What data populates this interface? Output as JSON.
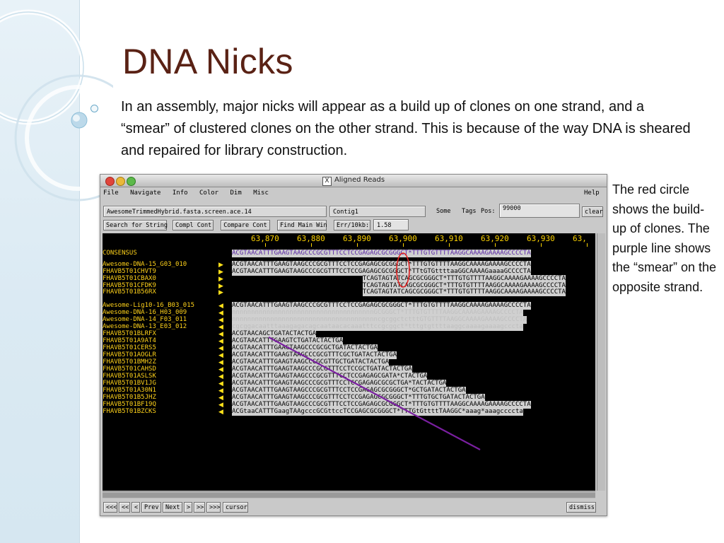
{
  "slide": {
    "title": "DNA Nicks",
    "intro": "In an assembly, major nicks will appear as a build up of clones on one strand, and a “smear” of clustered clones on the other strand. This is because of the way DNA is sheared and repaired for library construction.",
    "side_note": "The red circle shows the build-up of clones. The purple line shows the “smear” on the opposite strand."
  },
  "window": {
    "title": "Aligned Reads",
    "menu": [
      "File",
      "Navigate",
      "Info",
      "Color",
      "Dim",
      "Misc"
    ],
    "help": "Help",
    "file_field": "AwesomeTrimmedHybrid.fasta.screen.ace.14",
    "contig_field": "Contig1",
    "some_button": "Some",
    "tags_button": "Tags",
    "pos_label": "Pos:",
    "pos_value": "99000",
    "clear_button": "clear",
    "search_button": "Search for String",
    "compl_button": "Compl Cont",
    "compare_button": "Compare Cont",
    "findmain_button": "Find Main Win",
    "err_button": "Err/10kb:",
    "err_value": "1.58",
    "nav_buttons": [
      "<<<",
      "<<",
      "<",
      "Prev",
      "Next",
      ">",
      ">>",
      ">>>",
      "cursor"
    ],
    "dismiss_button": "dismiss"
  },
  "alignment": {
    "ruler": [
      "63,870",
      "63,880",
      "63,890",
      "63,900",
      "63,910",
      "63,920",
      "63,930",
      "63,"
    ],
    "consensus": {
      "name": "CONSENSUS",
      "seq": "ACGTAACATTTGAAGTAAGCCCGCGTTTCCTCCGAGAGCGCGGGCT*TTTGTGTTTTAAGGCAAAAGAAAAGCCCCTA"
    },
    "reads": [
      {
        "name": "Awesome-DNA-15_G03_010",
        "color": "#ffd21a",
        "dir": "right",
        "offset": 0,
        "seq": "ACGTAACATTTGAAGTAAGCCCGCGTTTCCTCCGAGAGCGCGGGCT*TTTGTGTTTTAAGGCAAAAGAAAAGCCCCTA"
      },
      {
        "name": "FHAVB5T01CHVT9",
        "color": "#ffd21a",
        "dir": "right",
        "offset": 0,
        "seq": "ACGTAACATTTGAAGTAAGCCCGCGTTTCCTCCGAGAGCGCGGGCT*TTtGTGttttaaGGCAAAAGaaaaGCCCCTA"
      },
      {
        "name": "FHAVB5T01CBAX0",
        "color": "#ffd21a",
        "dir": "right",
        "offset": 28,
        "seq": "TCAGTAGTATCAGCGCGGGCT*TTTGTGTTTTAAGGCAAAAGAAAAGCCCCTA"
      },
      {
        "name": "FHAVB5T01CFDK9",
        "color": "#ffd21a",
        "dir": "right",
        "offset": 28,
        "seq": "TCAGTAGTATCAGCGCGGGCT*TTTGTGTTTTAAGGCAAAAGAAAAGCCCCTA"
      },
      {
        "name": "FHAVB5T01B56RX",
        "color": "#ffd21a",
        "dir": "right",
        "offset": 28,
        "seq": "TCAGTAGTATCAGCGCGGGCT*TTTGTGTTTTAAGGCAAAAGAAAAGCCCCTA"
      },
      {
        "name": "Awesome-Lig10-16_B03_015",
        "color": "#ffd21a",
        "dir": "left",
        "offset": 0,
        "seq": "ACGTAACATTTGAAGTAAGCCCGCGTTTCCTCCGAGAGCGCGGGCT*TTTGTGTTTTAAGGCAAAAGAAAAGCCCCTA"
      },
      {
        "name": "Awesome-DNA-16_H03_009",
        "color": "#ffd21a",
        "dir": "left",
        "offset": 0,
        "seq": "nnnnnnnnnnnnnnnnnnnnnnnnnnnnnnnnnnnnnGCGGGCT*TTTGTGTTTTAAGGCAAAAGAAAAGCCCCTA",
        "dark": true
      },
      {
        "name": "Awesome-DNA-14_F03_011",
        "color": "#ffd21a",
        "dir": "left",
        "offset": 0,
        "seq": "nnnnnnnnnnnnnnnnnnnnnnnnnnnnnnnnnnnnnncgcggctctttGTGTTTTAAGGCAAAAGAAAAGCCCCTA",
        "dark": true
      },
      {
        "name": "Awesome-DNA-13_E03_012",
        "color": "#ffd21a",
        "dir": "left",
        "offset": 0,
        "seq": "cgcggacaatttaaagagacagcaataacacaaatttccgcggct*tttgtgttttaaggcaaaagaaaagcccta",
        "dark": true
      },
      {
        "name": "FHAVB5T01BLRFX",
        "color": "#ffd21a",
        "dir": "left",
        "offset": 0,
        "seq": "ACGTAACAGCTGATACTACTGA"
      },
      {
        "name": "FHAVB5T01A9AT4",
        "color": "#ffd21a",
        "dir": "left",
        "offset": 0,
        "seq": "ACGTAACATTTGAAGTCTGATACTACTGA"
      },
      {
        "name": "FHAVB5T01CERS5",
        "color": "#ffd21a",
        "dir": "left",
        "offset": 0,
        "seq": "ACGTAACATTTGAAGTAAGCCCGCGCTGATACTACTGA"
      },
      {
        "name": "FHAVB5T01AOGLR",
        "color": "#ffd21a",
        "dir": "left",
        "offset": 0,
        "seq": "ACGTAACATTTGAAGTAAGCCCGCGTTTCGCTGATACTACTGA"
      },
      {
        "name": "FHAVB5T01BMH2Z",
        "color": "#ffd21a",
        "dir": "left",
        "offset": 0,
        "seq": "ACGTAACATTTGAAGTAAGCCCGCGTTGCTGATACTACTGA"
      },
      {
        "name": "FHAVB5T01CAHSD",
        "color": "#ffd21a",
        "dir": "left",
        "offset": 0,
        "seq": "ACGTAACATTTGAAGTAAGCCCGCGTTTCCTCCGCTGATACTACTGA"
      },
      {
        "name": "FHAVB5T01ASLSK",
        "color": "#ffd21a",
        "dir": "left",
        "offset": 0,
        "seq": "ACGTAACATTTGAAGTAAGCCCGCGTTTCCTCCGAGAGCGATA*CTACTGA"
      },
      {
        "name": "FHAVB5T01BV1JG",
        "color": "#ffd21a",
        "dir": "left",
        "offset": 0,
        "seq": "ACGTAACATTTGAAGTAAGCCCGCGTTTCCTCCGAGAGCGCGCTGA*TACTACTGA"
      },
      {
        "name": "FHAVB5T01A30N1",
        "color": "#ffd21a",
        "dir": "left",
        "offset": 0,
        "seq": "ACGTAACATTTGAAGTAAGCCCGCGTTTCCTCCGAGAGCGCGGGCT*GCTGATACTACTGA"
      },
      {
        "name": "FHAVB5T01B5JHZ",
        "color": "#ffd21a",
        "dir": "left",
        "offset": 0,
        "seq": "ACGTAACATTTGAAGTAAGCCCGCGTTTCCTCCGAGAGCGCGGGCT*TTTGTGCTGATACTACTGA"
      },
      {
        "name": "FHAVB5T01BF19Q",
        "color": "#ffd21a",
        "dir": "left",
        "offset": 0,
        "seq": "ACGTAACATTTGAAGTAAGCCCGCGTTTCCTCCGAGAGCGCGGGCT*TTTGTGTTTTAAGGCAAAAGAAAAGCCCCTA"
      },
      {
        "name": "FHAVB5T01BZCKS",
        "color": "#ffd21a",
        "dir": "left",
        "offset": 0,
        "seq": "ACGtaaCATTTGaagTAAgcccGCGttccTCCGAGCGCGGGCT*TTTGtGttttTAAGGC*aaag*aaagccccta"
      }
    ]
  },
  "colors": {
    "title": "#5a2215",
    "consensus_text": "#5a26a6",
    "read_name": "#ffd21a",
    "red_circle": "#e02020",
    "purple_line": "#7a1fa0"
  }
}
